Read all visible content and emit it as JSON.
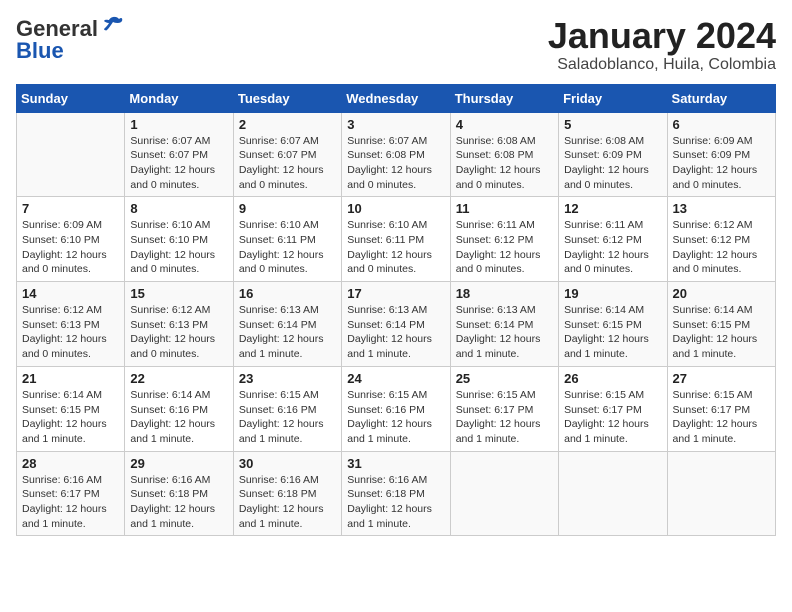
{
  "header": {
    "logo_general": "General",
    "logo_blue": "Blue",
    "title": "January 2024",
    "subtitle": "Saladoblanco, Huila, Colombia"
  },
  "days_of_week": [
    "Sunday",
    "Monday",
    "Tuesday",
    "Wednesday",
    "Thursday",
    "Friday",
    "Saturday"
  ],
  "weeks": [
    [
      {
        "day": "",
        "info": ""
      },
      {
        "day": "1",
        "info": "Sunrise: 6:07 AM\nSunset: 6:07 PM\nDaylight: 12 hours\nand 0 minutes."
      },
      {
        "day": "2",
        "info": "Sunrise: 6:07 AM\nSunset: 6:07 PM\nDaylight: 12 hours\nand 0 minutes."
      },
      {
        "day": "3",
        "info": "Sunrise: 6:07 AM\nSunset: 6:08 PM\nDaylight: 12 hours\nand 0 minutes."
      },
      {
        "day": "4",
        "info": "Sunrise: 6:08 AM\nSunset: 6:08 PM\nDaylight: 12 hours\nand 0 minutes."
      },
      {
        "day": "5",
        "info": "Sunrise: 6:08 AM\nSunset: 6:09 PM\nDaylight: 12 hours\nand 0 minutes."
      },
      {
        "day": "6",
        "info": "Sunrise: 6:09 AM\nSunset: 6:09 PM\nDaylight: 12 hours\nand 0 minutes."
      }
    ],
    [
      {
        "day": "7",
        "info": "Sunrise: 6:09 AM\nSunset: 6:10 PM\nDaylight: 12 hours\nand 0 minutes."
      },
      {
        "day": "8",
        "info": "Sunrise: 6:10 AM\nSunset: 6:10 PM\nDaylight: 12 hours\nand 0 minutes."
      },
      {
        "day": "9",
        "info": "Sunrise: 6:10 AM\nSunset: 6:11 PM\nDaylight: 12 hours\nand 0 minutes."
      },
      {
        "day": "10",
        "info": "Sunrise: 6:10 AM\nSunset: 6:11 PM\nDaylight: 12 hours\nand 0 minutes."
      },
      {
        "day": "11",
        "info": "Sunrise: 6:11 AM\nSunset: 6:12 PM\nDaylight: 12 hours\nand 0 minutes."
      },
      {
        "day": "12",
        "info": "Sunrise: 6:11 AM\nSunset: 6:12 PM\nDaylight: 12 hours\nand 0 minutes."
      },
      {
        "day": "13",
        "info": "Sunrise: 6:12 AM\nSunset: 6:12 PM\nDaylight: 12 hours\nand 0 minutes."
      }
    ],
    [
      {
        "day": "14",
        "info": "Sunrise: 6:12 AM\nSunset: 6:13 PM\nDaylight: 12 hours\nand 0 minutes."
      },
      {
        "day": "15",
        "info": "Sunrise: 6:12 AM\nSunset: 6:13 PM\nDaylight: 12 hours\nand 0 minutes."
      },
      {
        "day": "16",
        "info": "Sunrise: 6:13 AM\nSunset: 6:14 PM\nDaylight: 12 hours\nand 1 minute."
      },
      {
        "day": "17",
        "info": "Sunrise: 6:13 AM\nSunset: 6:14 PM\nDaylight: 12 hours\nand 1 minute."
      },
      {
        "day": "18",
        "info": "Sunrise: 6:13 AM\nSunset: 6:14 PM\nDaylight: 12 hours\nand 1 minute."
      },
      {
        "day": "19",
        "info": "Sunrise: 6:14 AM\nSunset: 6:15 PM\nDaylight: 12 hours\nand 1 minute."
      },
      {
        "day": "20",
        "info": "Sunrise: 6:14 AM\nSunset: 6:15 PM\nDaylight: 12 hours\nand 1 minute."
      }
    ],
    [
      {
        "day": "21",
        "info": "Sunrise: 6:14 AM\nSunset: 6:15 PM\nDaylight: 12 hours\nand 1 minute."
      },
      {
        "day": "22",
        "info": "Sunrise: 6:14 AM\nSunset: 6:16 PM\nDaylight: 12 hours\nand 1 minute."
      },
      {
        "day": "23",
        "info": "Sunrise: 6:15 AM\nSunset: 6:16 PM\nDaylight: 12 hours\nand 1 minute."
      },
      {
        "day": "24",
        "info": "Sunrise: 6:15 AM\nSunset: 6:16 PM\nDaylight: 12 hours\nand 1 minute."
      },
      {
        "day": "25",
        "info": "Sunrise: 6:15 AM\nSunset: 6:17 PM\nDaylight: 12 hours\nand 1 minute."
      },
      {
        "day": "26",
        "info": "Sunrise: 6:15 AM\nSunset: 6:17 PM\nDaylight: 12 hours\nand 1 minute."
      },
      {
        "day": "27",
        "info": "Sunrise: 6:15 AM\nSunset: 6:17 PM\nDaylight: 12 hours\nand 1 minute."
      }
    ],
    [
      {
        "day": "28",
        "info": "Sunrise: 6:16 AM\nSunset: 6:17 PM\nDaylight: 12 hours\nand 1 minute."
      },
      {
        "day": "29",
        "info": "Sunrise: 6:16 AM\nSunset: 6:18 PM\nDaylight: 12 hours\nand 1 minute."
      },
      {
        "day": "30",
        "info": "Sunrise: 6:16 AM\nSunset: 6:18 PM\nDaylight: 12 hours\nand 1 minute."
      },
      {
        "day": "31",
        "info": "Sunrise: 6:16 AM\nSunset: 6:18 PM\nDaylight: 12 hours\nand 1 minute."
      },
      {
        "day": "",
        "info": ""
      },
      {
        "day": "",
        "info": ""
      },
      {
        "day": "",
        "info": ""
      }
    ]
  ]
}
